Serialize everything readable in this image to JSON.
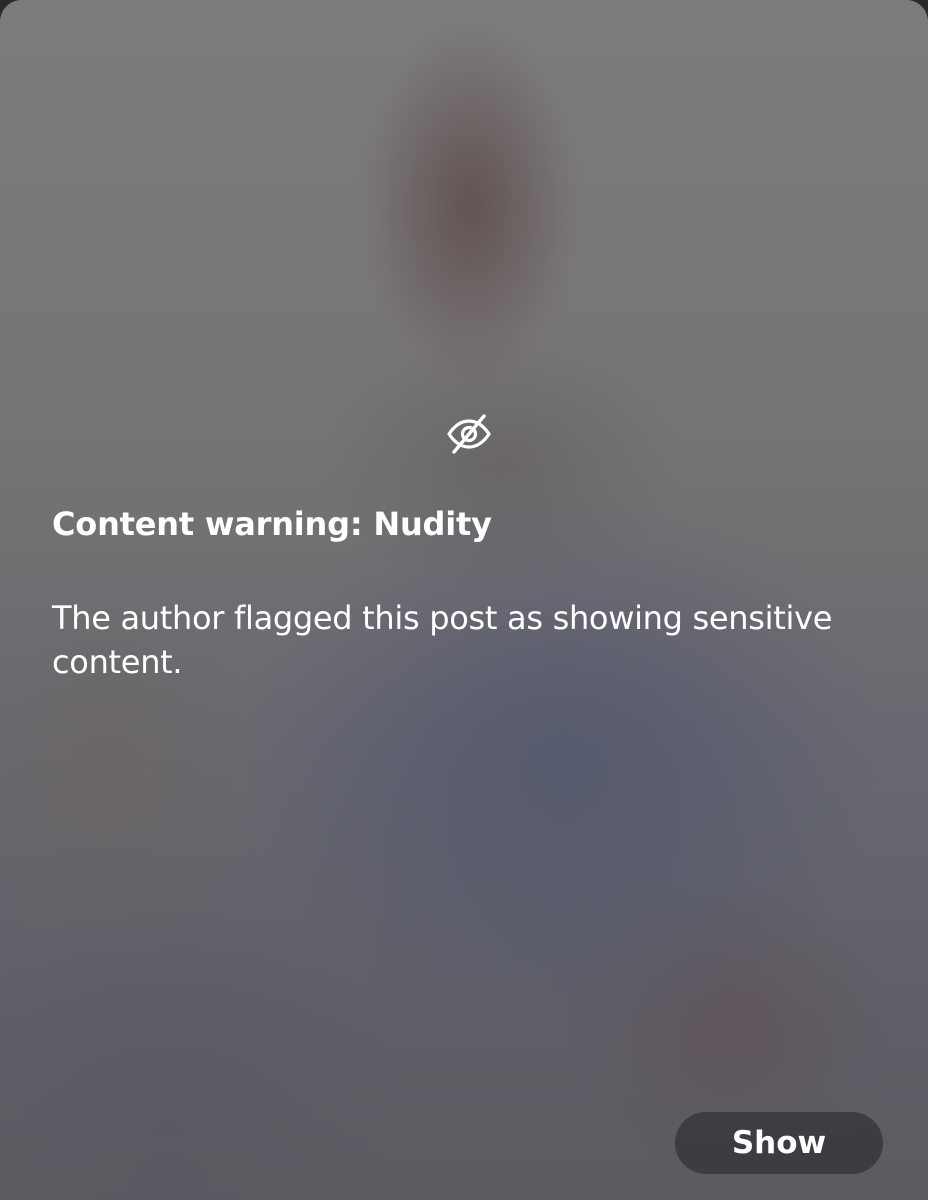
{
  "warning": {
    "icon": "eye-slash-icon",
    "title": "Content warning: Nudity",
    "message": "The author flagged this post as showing sensitive content."
  },
  "actions": {
    "show_label": "Show"
  }
}
